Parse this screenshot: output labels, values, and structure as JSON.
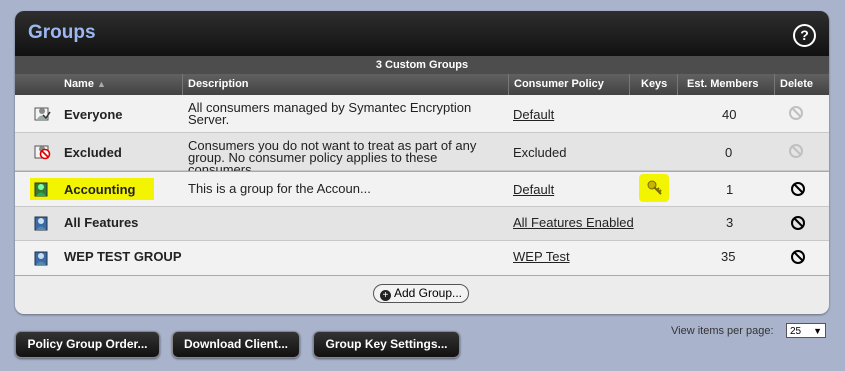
{
  "panel": {
    "title": "Groups",
    "help_glyph": "?",
    "count_label": "3 Custom Groups"
  },
  "columns": {
    "name": "Name",
    "sort_indicator": "▲",
    "description": "Description",
    "policy": "Consumer Policy",
    "keys": "Keys",
    "members": "Est. Members",
    "delete": "Delete"
  },
  "rows": [
    {
      "name": "Everyone",
      "description": "All consumers managed by Symantec Encryption Server.",
      "policy": "Default",
      "policy_link": true,
      "members": "40",
      "deletable": false,
      "icon": "everyone-group-icon"
    },
    {
      "name": "Excluded",
      "description": "Consumers you do not want to treat as part of any group. No consumer policy applies to these consumers.",
      "policy": "Excluded",
      "policy_link": false,
      "members": "0",
      "deletable": false,
      "icon": "excluded-group-icon"
    },
    {
      "name": "Accounting",
      "description": "This is a group for the Accoun...",
      "policy": "Default",
      "policy_link": true,
      "members": "1",
      "deletable": true,
      "has_key": true,
      "icon": "custom-group-icon"
    },
    {
      "name": "All Features",
      "description": "",
      "policy": "All Features Enabled",
      "policy_link": true,
      "members": "3",
      "deletable": true,
      "icon": "custom-group-icon"
    },
    {
      "name": "WEP TEST GROUP",
      "description": "",
      "policy": "WEP Test",
      "policy_link": true,
      "members": "35",
      "deletable": true,
      "icon": "custom-group-icon"
    }
  ],
  "add_group_label": "Add Group...",
  "footer": {
    "policy_group_order": "Policy Group Order...",
    "download_client": "Download Client...",
    "group_key_settings": "Group Key Settings...",
    "view_items_label": "View items per page:",
    "view_items_value": "25"
  },
  "colors": {
    "highlight": "#f3f500",
    "link": "#1a3d9e",
    "title": "#9bb8f0"
  }
}
